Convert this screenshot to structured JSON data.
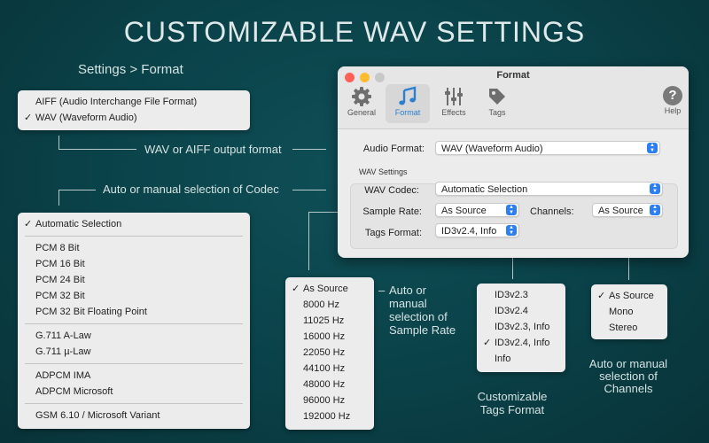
{
  "headline": "CUSTOMIZABLE WAV SETTINGS",
  "breadcrumb": "Settings > Format",
  "notes": {
    "output_format": "WAV or AIFF output format",
    "codec": "Auto or manual selection of Codec",
    "sample_rate": [
      "Auto or",
      "manual",
      "selection of",
      "Sample Rate"
    ],
    "sample_rate_dash": "–",
    "tags": [
      "Customizable",
      "Tags Format"
    ],
    "channels": [
      "Auto or manual",
      "selection of",
      "Channels"
    ]
  },
  "format_menu": {
    "items": [
      {
        "label": "AIFF (Audio Interchange File Format)",
        "checked": false
      },
      {
        "label": "WAV (Waveform Audio)",
        "checked": true
      }
    ]
  },
  "codec_menu": {
    "groups": [
      [
        {
          "label": "Automatic Selection",
          "checked": true
        }
      ],
      [
        {
          "label": "PCM 8 Bit"
        },
        {
          "label": "PCM 16 Bit"
        },
        {
          "label": "PCM 24 Bit"
        },
        {
          "label": "PCM 32 Bit"
        },
        {
          "label": "PCM 32 Bit Floating Point"
        }
      ],
      [
        {
          "label": "G.711 A-Law"
        },
        {
          "label": "G.711 µ-Law"
        }
      ],
      [
        {
          "label": "ADPCM IMA"
        },
        {
          "label": "ADPCM Microsoft"
        }
      ],
      [
        {
          "label": "GSM 6.10 / Microsoft Variant"
        }
      ]
    ]
  },
  "sample_rate_menu": {
    "items": [
      {
        "label": "As Source",
        "checked": true
      },
      {
        "label": "8000 Hz"
      },
      {
        "label": "11025 Hz"
      },
      {
        "label": "16000 Hz"
      },
      {
        "label": "22050 Hz"
      },
      {
        "label": "44100 Hz"
      },
      {
        "label": "48000 Hz"
      },
      {
        "label": "96000 Hz"
      },
      {
        "label": "192000 Hz"
      }
    ]
  },
  "tags_menu": {
    "items": [
      {
        "label": "ID3v2.3"
      },
      {
        "label": "ID3v2.4"
      },
      {
        "label": "ID3v2.3, Info"
      },
      {
        "label": "ID3v2.4, Info",
        "checked": true
      },
      {
        "label": "Info"
      }
    ]
  },
  "channels_menu": {
    "items": [
      {
        "label": "As Source",
        "checked": true
      },
      {
        "label": "Mono"
      },
      {
        "label": "Stereo"
      }
    ]
  },
  "check_glyph": "✓",
  "window": {
    "title": "Format",
    "toolbar": [
      {
        "label": "General",
        "icon": "gear-icon"
      },
      {
        "label": "Format",
        "icon": "music-note-icon",
        "active": true
      },
      {
        "label": "Effects",
        "icon": "sliders-icon"
      },
      {
        "label": "Tags",
        "icon": "tag-icon"
      }
    ],
    "help_label": "Help",
    "help_glyph": "?",
    "audio_format_label": "Audio Format:",
    "audio_format_value": "WAV (Waveform Audio)",
    "group_title": "WAV Settings",
    "codec_label": "WAV Codec:",
    "codec_value": "Automatic Selection",
    "sample_rate_label": "Sample Rate:",
    "sample_rate_value": "As Source",
    "channels_label": "Channels:",
    "channels_value": "As Source",
    "tags_label": "Tags Format:",
    "tags_value": "ID3v2.4, Info"
  },
  "colors": {
    "background": "#0a4148",
    "accent": "#2b7ff3",
    "close": "#ff5f57",
    "minimize": "#febc2e",
    "zoom": "#c8c8c8"
  }
}
